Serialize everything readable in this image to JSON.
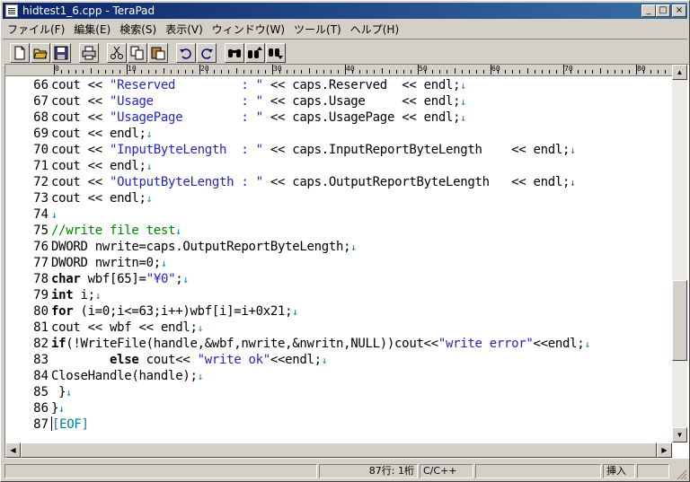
{
  "window": {
    "title": "hidtest1_6.cpp - TeraPad",
    "controls": {
      "minimize": "_",
      "maximize": "□",
      "close": "×"
    }
  },
  "menu": [
    "ファイル(F)",
    "編集(E)",
    "検索(S)",
    "表示(V)",
    "ウィンドウ(W)",
    "ツール(T)",
    "ヘルプ(H)"
  ],
  "toolbar": {
    "buttons": [
      "new-file-icon",
      "open-folder-icon",
      "save-icon",
      "print-icon",
      "cut-icon",
      "copy-icon",
      "paste-icon",
      "undo-icon",
      "redo-icon",
      "find-icon",
      "find-prev-icon",
      "find-next-icon"
    ]
  },
  "ruler": {
    "labels": [
      "0",
      "10",
      "20",
      "30",
      "40",
      "50",
      "60",
      "70",
      "80"
    ]
  },
  "editor": {
    "line_numbers": [
      "66",
      "67",
      "68",
      "69",
      "70",
      "71",
      "72",
      "73",
      "74",
      "75",
      "76",
      "77",
      "78",
      "79",
      "80",
      "81",
      "82",
      "83",
      "84",
      "85",
      "86",
      "87"
    ],
    "lines": [
      [
        {
          "t": "cout << "
        },
        {
          "t": "\"Reserved         : \"",
          "c": "str"
        },
        {
          "t": " << caps.Reserved  << endl;"
        },
        {
          "t": "↓",
          "c": "eol"
        }
      ],
      [
        {
          "t": "cout << "
        },
        {
          "t": "\"Usage            : \"",
          "c": "str"
        },
        {
          "t": " << caps.Usage     << endl;"
        },
        {
          "t": "↓",
          "c": "eol"
        }
      ],
      [
        {
          "t": "cout << "
        },
        {
          "t": "\"UsagePage        : \"",
          "c": "str"
        },
        {
          "t": " << caps.UsagePage << endl;"
        },
        {
          "t": "↓",
          "c": "eol"
        }
      ],
      [
        {
          "t": "cout << endl;"
        },
        {
          "t": "↓",
          "c": "eol"
        }
      ],
      [
        {
          "t": "cout << "
        },
        {
          "t": "\"InputByteLength  : \"",
          "c": "str"
        },
        {
          "t": " << caps.InputReportByteLength    << endl;"
        },
        {
          "t": "↓",
          "c": "eol"
        }
      ],
      [
        {
          "t": "cout << endl;"
        },
        {
          "t": "↓",
          "c": "eol"
        }
      ],
      [
        {
          "t": "cout << "
        },
        {
          "t": "\"OutputByteLength : \"",
          "c": "str"
        },
        {
          "t": " << caps.OutputReportByteLength   << endl;"
        },
        {
          "t": "↓",
          "c": "eol"
        }
      ],
      [
        {
          "t": "cout << endl;"
        },
        {
          "t": "↓",
          "c": "eol"
        }
      ],
      [
        {
          "t": "↓",
          "c": "eol"
        }
      ],
      [
        {
          "t": "//write file test",
          "c": "cmt"
        },
        {
          "t": "↓",
          "c": "eol"
        }
      ],
      [
        {
          "t": "DWORD nwrite=caps.OutputReportByteLength;"
        },
        {
          "t": "↓",
          "c": "eol"
        }
      ],
      [
        {
          "t": "DWORD nwritn=0;"
        },
        {
          "t": "↓",
          "c": "eol"
        }
      ],
      [
        {
          "t": "char",
          "c": "kw"
        },
        {
          "t": " wbf[65]="
        },
        {
          "t": "\"¥0\"",
          "c": "str"
        },
        {
          "t": ";"
        },
        {
          "t": "↓",
          "c": "eol"
        }
      ],
      [
        {
          "t": "int",
          "c": "kw"
        },
        {
          "t": " i;"
        },
        {
          "t": "↓",
          "c": "eol"
        }
      ],
      [
        {
          "t": "for",
          "c": "kw"
        },
        {
          "t": " (i=0;i<=63;i++)wbf[i]=i+0x21;"
        },
        {
          "t": "↓",
          "c": "eol"
        }
      ],
      [
        {
          "t": "cout << wbf << endl;"
        },
        {
          "t": "↓",
          "c": "eol"
        }
      ],
      [
        {
          "t": "if",
          "c": "kw"
        },
        {
          "t": "(!WriteFile(handle,&wbf,nwrite,&nwritn,NULL))cout<<"
        },
        {
          "t": "\"write error\"",
          "c": "str"
        },
        {
          "t": "<<endl;"
        },
        {
          "t": "↓",
          "c": "eol"
        }
      ],
      [
        {
          "t": "        "
        },
        {
          "t": "else",
          "c": "kw"
        },
        {
          "t": " cout<< "
        },
        {
          "t": "\"write ok\"",
          "c": "str"
        },
        {
          "t": "<<endl;"
        },
        {
          "t": "↓",
          "c": "eol"
        }
      ],
      [
        {
          "t": "CloseHandle(handle);"
        },
        {
          "t": "↓",
          "c": "eol"
        }
      ],
      [
        {
          "t": " }"
        },
        {
          "t": "↓",
          "c": "eol"
        }
      ],
      [
        {
          "t": "}"
        },
        {
          "t": "↓",
          "c": "eol"
        }
      ],
      [
        {
          "t": "[EOF]",
          "c": "eof"
        }
      ]
    ]
  },
  "status": {
    "position": "87行:    1桁",
    "language": "C/C++",
    "mode": "挿入"
  }
}
